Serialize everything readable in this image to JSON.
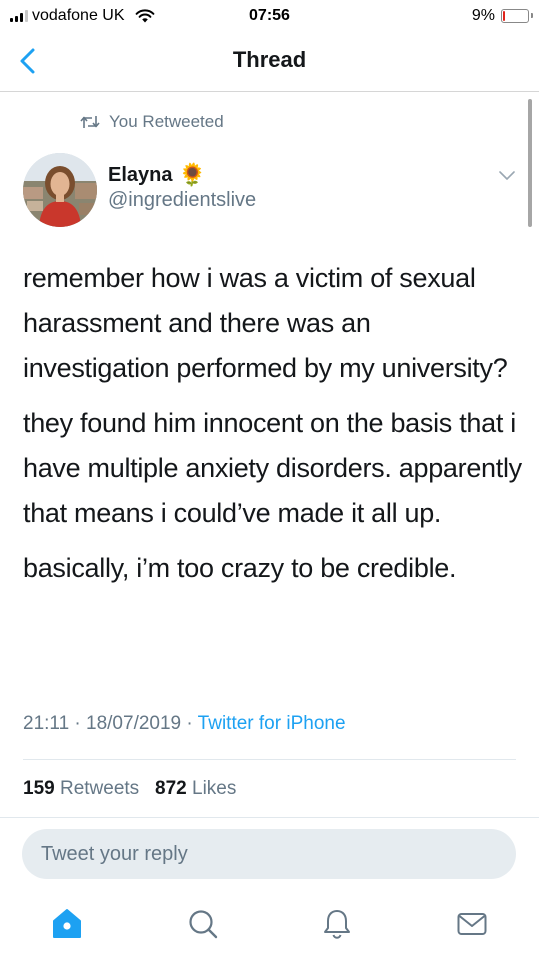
{
  "status_bar": {
    "carrier": "vodafone UK",
    "time": "07:56",
    "battery_percent": "9%",
    "battery_level": 0.09,
    "battery_color": "#e0241b",
    "signal_icon": "signal-bars-icon",
    "wifi_icon": "wifi-icon"
  },
  "nav": {
    "title": "Thread",
    "back_icon": "chevron-left-icon"
  },
  "tweet": {
    "retweet_context": "You Retweeted",
    "author_name": "Elayna",
    "author_emoji": "🌻",
    "author_handle": "@ingredientslive",
    "paragraphs": [
      "remember how i was a victim of sexual harassment and there was an investigation performed by my university?",
      "they found him innocent on the basis that i have multiple anxiety disorders. apparently that means i could’ve made it all up.",
      "basically, i’m too crazy to be credible."
    ],
    "timestamp": "21:11 · 18/07/2019",
    "meta_separator": " · ",
    "source": "Twitter for iPhone",
    "retweet_count": "159",
    "retweets_label": "Retweets",
    "like_count": "872",
    "likes_label": "Likes"
  },
  "reply": {
    "placeholder": "Tweet your reply"
  },
  "tab_bar": {
    "items": [
      {
        "name": "home",
        "icon": "home-icon",
        "active": true
      },
      {
        "name": "search",
        "icon": "search-icon",
        "active": false
      },
      {
        "name": "notifications",
        "icon": "bell-icon",
        "active": false
      },
      {
        "name": "messages",
        "icon": "mail-icon",
        "active": false
      }
    ]
  },
  "colors": {
    "accent": "#1da1f2",
    "secondary_text": "#657786",
    "primary_text": "#14171a",
    "reply_bg": "#e6ecf0"
  }
}
